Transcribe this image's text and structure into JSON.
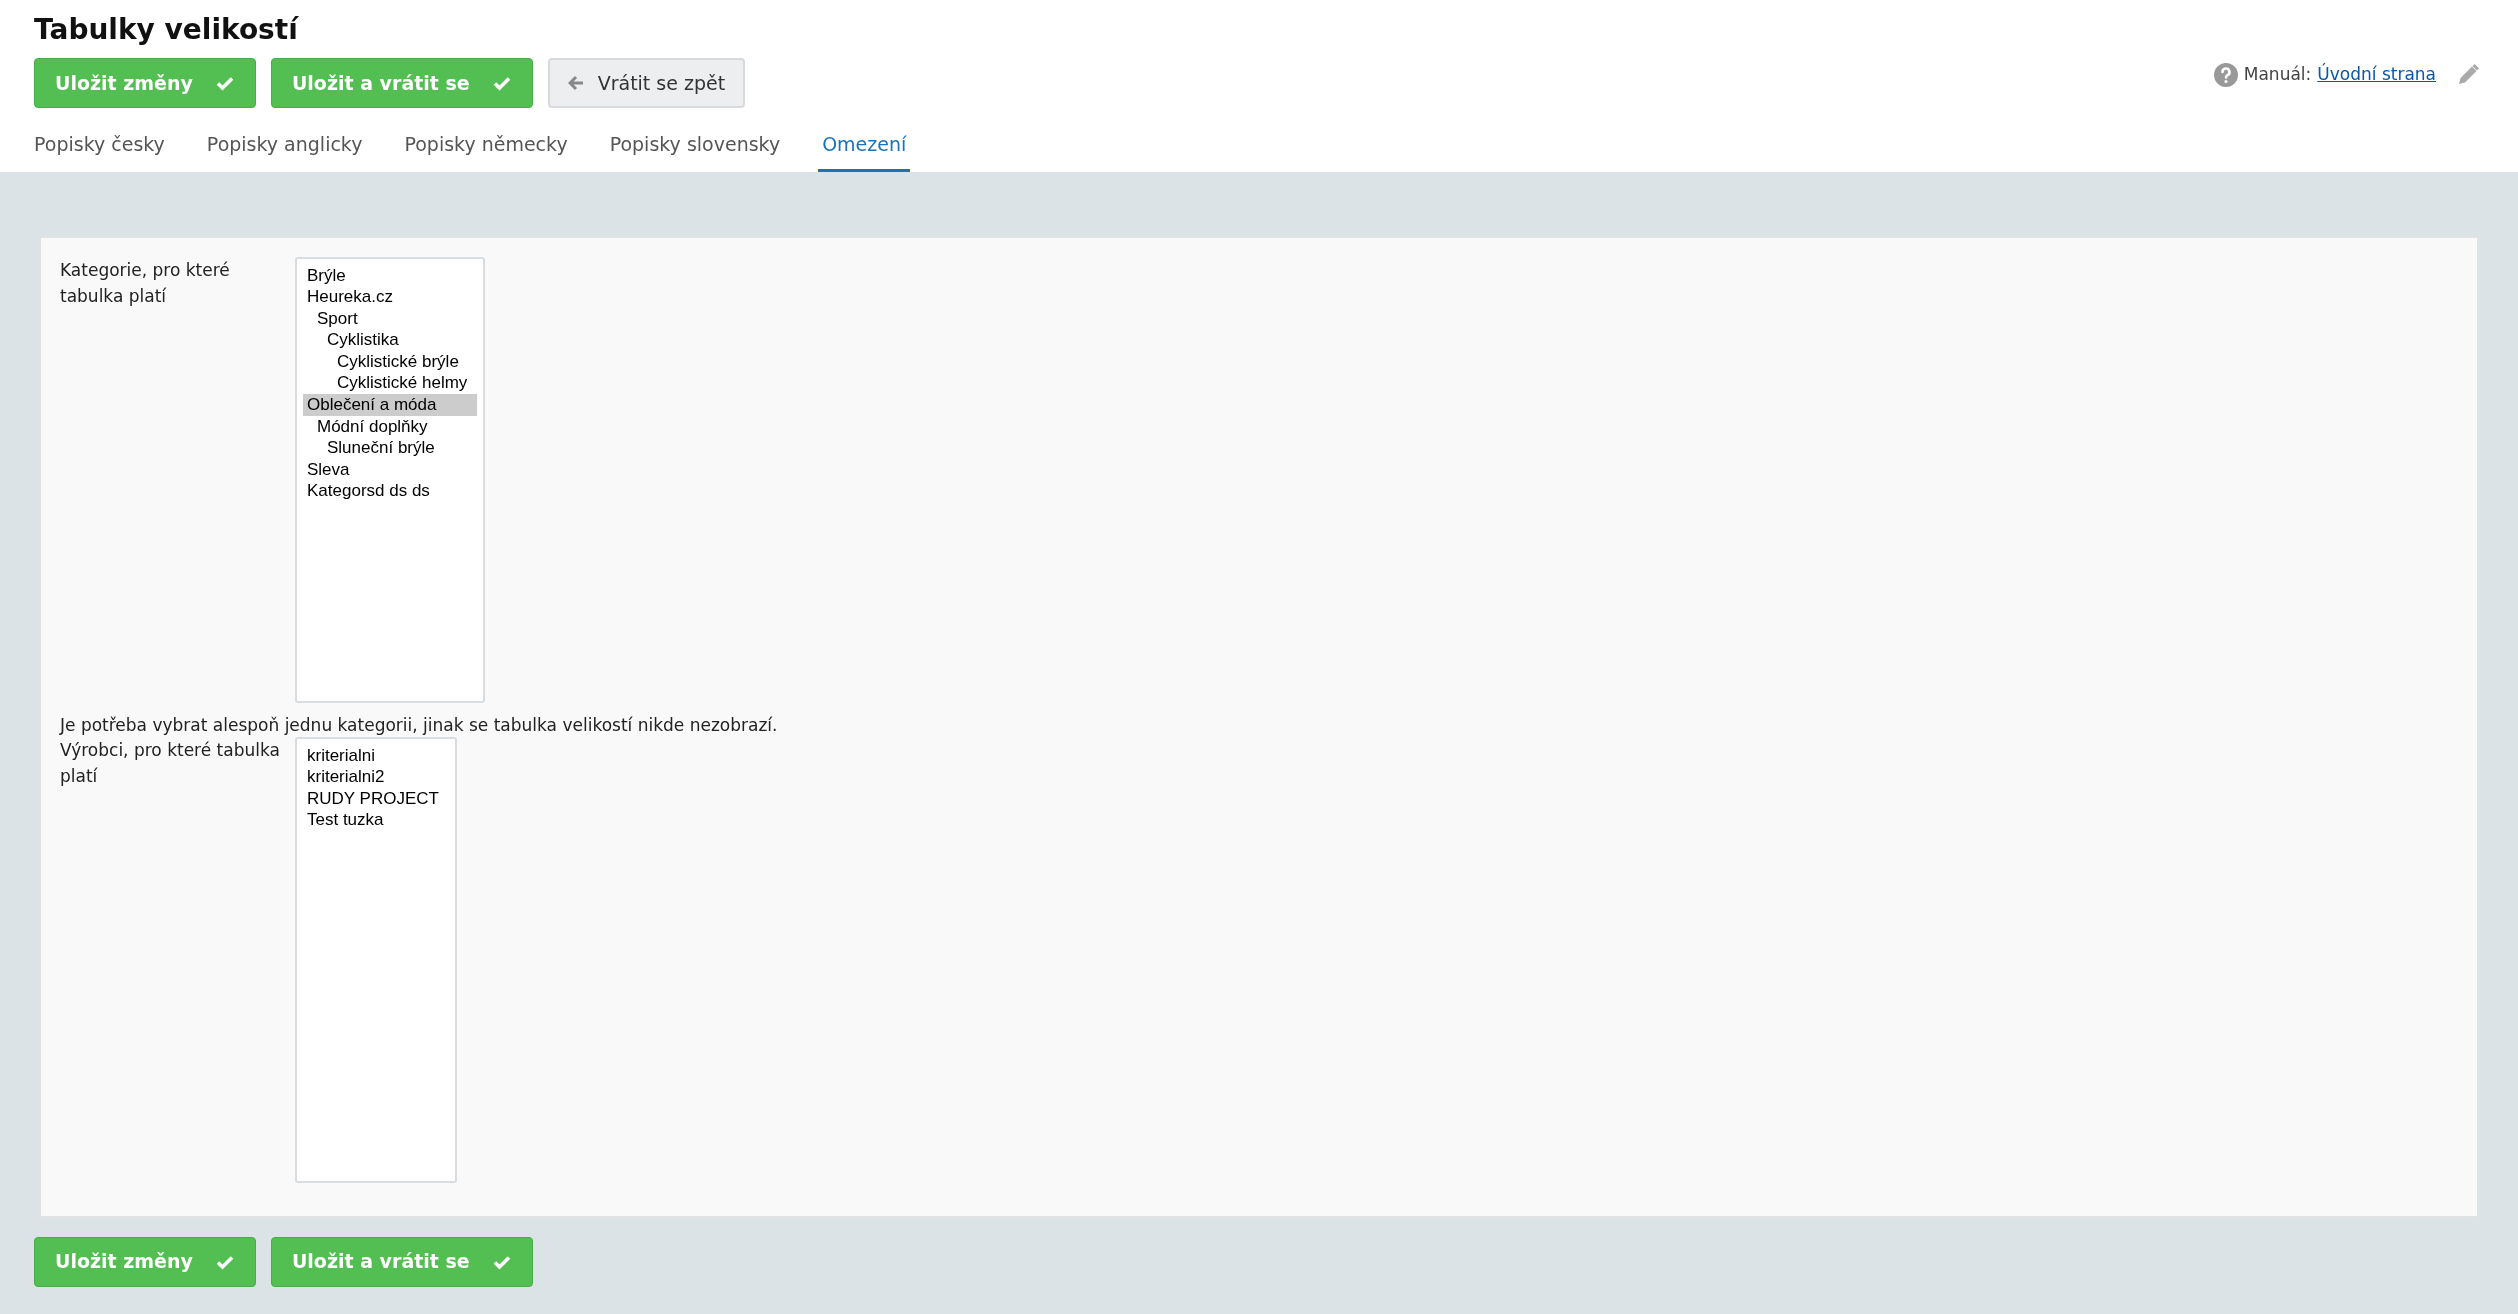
{
  "page_title": "Tabulky velikostí",
  "top_buttons": [
    {
      "label": "Uložit změny",
      "kind": "save"
    },
    {
      "label": "Uložit a vrátit se",
      "kind": "save"
    },
    {
      "label": "Vrátit se zpět",
      "kind": "back"
    }
  ],
  "manual": {
    "label": "Manuál:",
    "link": "Úvodní strana"
  },
  "tabs": [
    {
      "label": "Popisky česky",
      "selected": false
    },
    {
      "label": "Popisky anglicky",
      "selected": false
    },
    {
      "label": "Popisky německy",
      "selected": false
    },
    {
      "label": "Popisky slovensky",
      "selected": false
    },
    {
      "label": "Omezení",
      "selected": true
    }
  ],
  "categories": {
    "label": "Kategorie, pro které tabulka platí",
    "items": [
      {
        "label": "Brýle",
        "selected": false
      },
      {
        "label": "Heureka.cz",
        "selected": false,
        "children": [
          {
            "label": "Sport",
            "selected": false,
            "children": [
              {
                "label": "Cyklistika",
                "selected": false,
                "children": [
                  {
                    "label": "Cyklistické brýle",
                    "selected": false
                  },
                  {
                    "label": "Cyklistické helmy",
                    "selected": false
                  }
                ]
              }
            ]
          }
        ]
      },
      {
        "label": "Oblečení a móda",
        "selected": true,
        "children": [
          {
            "label": "Módní doplňky",
            "selected": false,
            "children": [
              {
                "label": "Sluneční brýle",
                "selected": false
              }
            ]
          }
        ]
      },
      {
        "label": "Sleva",
        "selected": false
      },
      {
        "label": "Kategorsd ds ds",
        "selected": false
      }
    ],
    "hint": "Je potřeba vybrat alespoň jednu kategorii, jinak se tabulka velikostí nikde nezobrazí."
  },
  "manufacturers": {
    "label": "Výrobci, pro které tabulka platí",
    "items": [
      {
        "label": "kriterialni",
        "selected": false
      },
      {
        "label": "kriterialni2",
        "selected": false
      },
      {
        "label": "RUDY PROJECT",
        "selected": false
      },
      {
        "label": "Test tuzka",
        "selected": false
      }
    ]
  },
  "bottom_buttons": [
    {
      "label": "Uložit změny",
      "kind": "save"
    },
    {
      "label": "Uložit a vrátit se",
      "kind": "save"
    }
  ]
}
